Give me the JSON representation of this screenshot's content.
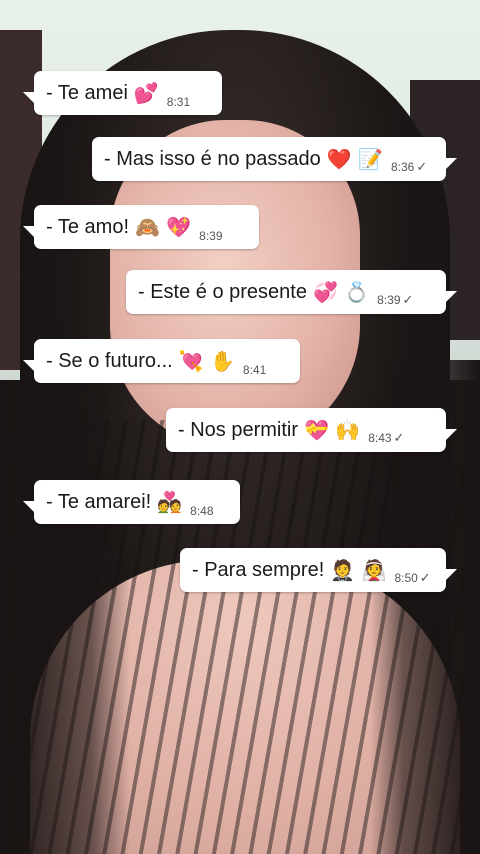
{
  "messages": [
    {
      "text": "- Te amei",
      "emoji": "💕",
      "time": "8:31",
      "dir": "in"
    },
    {
      "text": "- Mas isso é no passado",
      "emoji": "❤️ 📝",
      "time": "8:36",
      "dir": "out",
      "check": "✓"
    },
    {
      "text": "- Te amo!",
      "emoji": "🙈 💖",
      "time": "8:39",
      "dir": "in"
    },
    {
      "text": "- Este é o presente",
      "emoji": "💞 💍",
      "time": "8:39",
      "dir": "out",
      "check": "✓"
    },
    {
      "text": "- Se o futuro...",
      "emoji": "💘 ✋",
      "time": "8:41",
      "dir": "in"
    },
    {
      "text": "- Nos permitir",
      "emoji": "💝 🙌",
      "time": "8:43",
      "dir": "out",
      "check": "✓"
    },
    {
      "text": "- Te amarei!",
      "emoji": "💑",
      "time": "8:48",
      "dir": "in"
    },
    {
      "text": "- Para sempre!",
      "emoji": "🤵 👰",
      "time": "8:50",
      "dir": "out",
      "check": "✓"
    }
  ],
  "colors": {
    "bubble": "#ffffff",
    "text": "#1b1b1b",
    "meta": "#555555"
  }
}
